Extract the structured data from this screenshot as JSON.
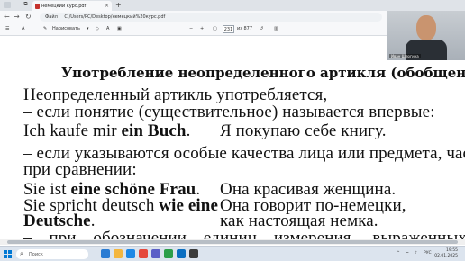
{
  "browser": {
    "tab_title": "немецкий курс.pdf",
    "url_label": "Файл",
    "url": "C:/Users/PC/Desktop/немецкий%20курс.pdf"
  },
  "pdf_toolbar": {
    "draw_label": "Нарисовать",
    "page_current": "231",
    "page_total": "из 877"
  },
  "document": {
    "heading": "Употребление неопределенного артикля (обобщение)",
    "lines": [
      "Неопределенный артикль употребляется,",
      "– если понятие (существительное) называется впервые:",
      "– если указываются особые качества лица или предмета, часто",
      "при сравнении:",
      "– при обозначении единиц измерения, выраженных"
    ],
    "ex1_de_pre": "Ich kaufe mir ",
    "ex1_de_bold": "ein Buch",
    "ex1_de_post": ".",
    "ex1_ru": "Я покупаю себе книгу.",
    "ex2_de_pre": "Sie ist ",
    "ex2_de_bold": "eine schöne Frau",
    "ex2_de_post": ".",
    "ex2_ru": "Она красивая женщина.",
    "ex3_de_pre": "Sie spricht deutsch ",
    "ex3_de_bold": "wie eine",
    "ex3_ru": "Она говорит по-немецки,",
    "ex4_de_bold": "Deutsche",
    "ex4_de_post": ".",
    "ex4_ru": "как настоящая немка."
  },
  "webcam": {
    "name": "Иван Шергина"
  },
  "taskbar": {
    "search_placeholder": "Поиск",
    "lang": "РУС",
    "time": "19:55",
    "date": "02.01.2025"
  },
  "colors": {
    "accent": "#0078d4",
    "pdf_icon": "#c5322d"
  }
}
